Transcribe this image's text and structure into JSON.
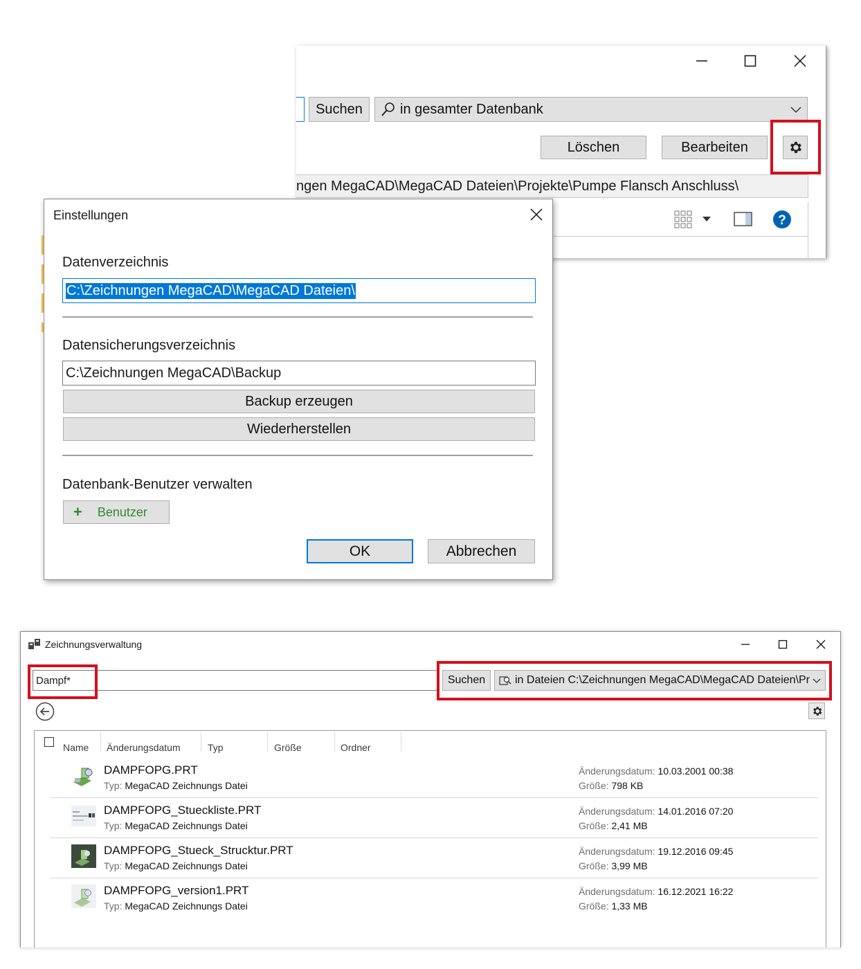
{
  "top_window": {
    "search_button": "Suchen",
    "scope_select": "in gesamter Datenbank",
    "delete_button": "Löschen",
    "edit_button": "Bearbeiten",
    "path": "ngen MegaCAD\\MegaCAD Dateien\\Projekte\\Pumpe Flansch Anschluss\\"
  },
  "settings_dialog": {
    "title": "Einstellungen",
    "data_dir_label": "Datenverzeichnis",
    "data_dir_value": "C:\\Zeichnungen MegaCAD\\MegaCAD Dateien\\",
    "backup_dir_label": "Datensicherungsverzeichnis",
    "backup_dir_value": "C:\\Zeichnungen MegaCAD\\Backup",
    "create_backup_button": "Backup erzeugen",
    "restore_button": "Wiederherstellen",
    "users_label": "Datenbank-Benutzer verwalten",
    "users_button": "Benutzer",
    "ok_button": "OK",
    "cancel_button": "Abbrechen"
  },
  "main_window": {
    "title": "Zeichnungsverwaltung",
    "search_value": "Dampf*",
    "search_button": "Suchen",
    "scope_select": "in Dateien C:\\Zeichnungen MegaCAD\\MegaCAD Dateien\\Pr",
    "columns": [
      "Name",
      "Änderungsdatum",
      "Typ",
      "Größe",
      "Ordner"
    ],
    "type_key": "Typ:",
    "date_key": "Änderungsdatum:",
    "size_key": "Größe:",
    "files": [
      {
        "name": "DAMPFOPG.PRT",
        "type": "MegaCAD Zeichnungs Datei",
        "date": "10.03.2001 00:38",
        "size": "798 KB"
      },
      {
        "name": "DAMPFOPG_Stueckliste.PRT",
        "type": "MegaCAD Zeichnungs Datei",
        "date": "14.01.2016 07:20",
        "size": "2,41 MB"
      },
      {
        "name": "DAMPFOPG_Stueck_Strucktur.PRT",
        "type": "MegaCAD Zeichnungs Datei",
        "date": "19.12.2016 09:45",
        "size": "3,99 MB"
      },
      {
        "name": "DAMPFOPG_version1.PRT",
        "type": "MegaCAD Zeichnungs Datei",
        "date": "16.12.2021 16:22",
        "size": "1,33 MB"
      }
    ]
  },
  "colors": {
    "highlight_red": "#d3101d",
    "selection_blue": "#0078d7",
    "help_blue": "#0063b1",
    "add_green": "#2e8b2e"
  }
}
